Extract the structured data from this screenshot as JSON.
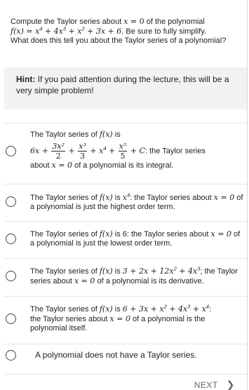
{
  "question": {
    "line1_pre": "Compute the Taylor series about ",
    "x": "x",
    "eq": " = 0",
    "line1_post": " of the polynomial",
    "poly_f": "f(x) = x",
    "poly_e1": "4",
    "poly_mid1": " + 4x",
    "poly_e2": "3",
    "poly_mid2": " + x",
    "poly_e3": "2",
    "poly_tail": " + 3x + 6",
    "line2_post": ". Be sure to fully simplify.",
    "line3": "What does this tell you about the Taylor series of a polynomial?"
  },
  "hint": {
    "label": "Hint:",
    "text": " If you paid attention during the lecture, this will be a very simple problem!"
  },
  "options": [
    {
      "l1": "The Taylor series of ",
      "fx": "f(x)",
      "l1b": " is",
      "t1": "6x + ",
      "f1n": "3x²",
      "f1d": "2",
      "plus1": " + ",
      "f2n": "x³",
      "f2d": "3",
      "t2": " + x",
      "e": "4",
      "plus2": " + ",
      "f3n": "x⁵",
      "f3d": "5",
      "t3": " + C",
      "t3b": ": the Taylor series",
      "l3a": "about ",
      "l3x": "x = 0",
      "l3b": " of a polynomial is its integral."
    },
    {
      "pre": "The Taylor series of ",
      "fx": "f(x)",
      "mid": " is ",
      "xp": "x",
      "e": "4",
      "post": ": the Taylor series about ",
      "x0": "x = 0",
      "post2": " of a polynomial is just the highest order term."
    },
    {
      "pre": "The Taylor series of ",
      "fx": "f(x)",
      "mid": " is 6: the Taylor series about ",
      "x0": "x = 0",
      "post2": " of a polynomial is just the lowest order term."
    },
    {
      "pre": "The Taylor series of ",
      "fx": "f(x)",
      "mid": " is ",
      "expr_a": "3 + 2x + 12x",
      "e1": "2",
      "expr_b": " + 4x",
      "e2": "3",
      "post": "; the Taylor series about ",
      "x0": "x = 0",
      "post2": " of a polynomial is its derivative."
    },
    {
      "pre": "The Taylor series of ",
      "fx": "f(x)",
      "mid": " is ",
      "expr_a": "6 + 3x + x",
      "e1": "2",
      "expr_b": " + 4x",
      "e2": "3",
      "expr_c": " + x",
      "e3": "4",
      "post": ":",
      "l2a": "the Taylor series about ",
      "x0": "x = 0",
      "l2b": " of a polynomial is the",
      "l3": "polynomial itself."
    },
    {
      "text": "A polynomial does not have a Taylor series."
    }
  ],
  "footer": {
    "next_label": "NEXT",
    "next_icon": "chevron-right-icon"
  }
}
